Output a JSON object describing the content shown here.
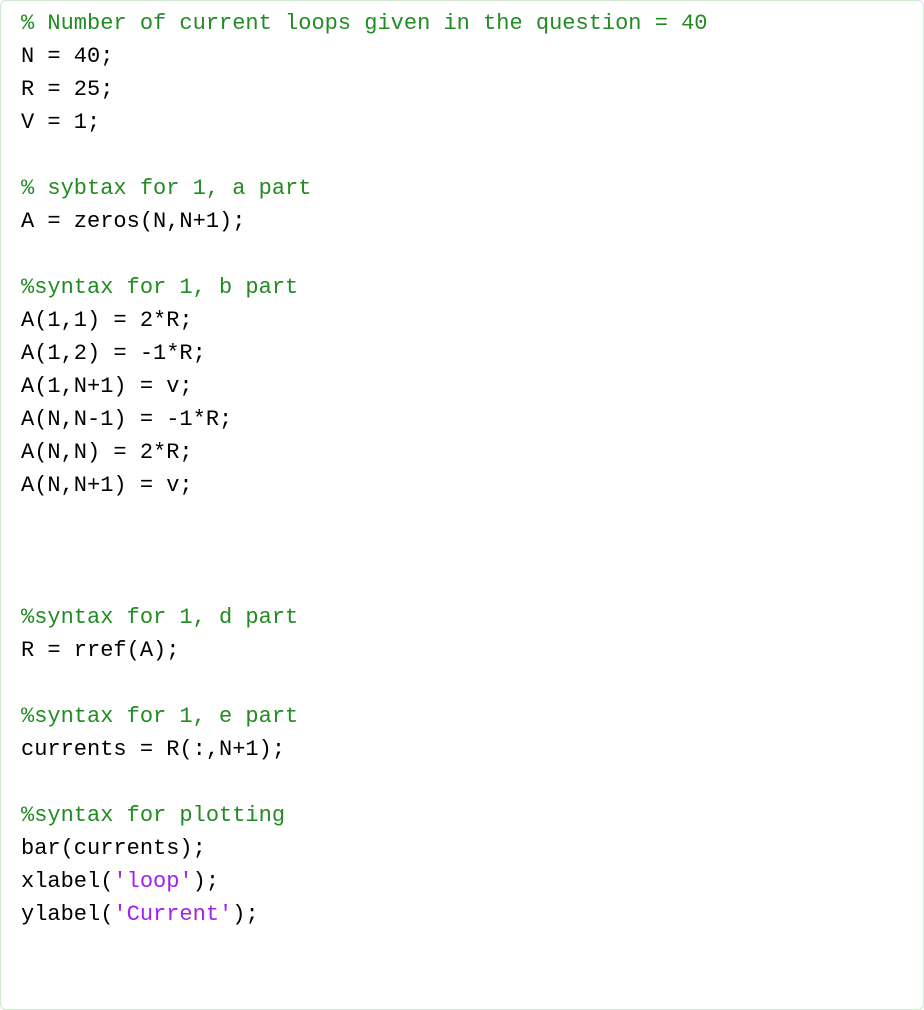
{
  "code": {
    "lines": [
      {
        "tokens": [
          {
            "cls": "tok-comment",
            "text": "% Number of current loops given in the question = 40"
          }
        ]
      },
      {
        "tokens": [
          {
            "cls": "tok-plain",
            "text": "N = 40;"
          }
        ]
      },
      {
        "tokens": [
          {
            "cls": "tok-plain",
            "text": "R = 25;"
          }
        ]
      },
      {
        "tokens": [
          {
            "cls": "tok-plain",
            "text": "V = 1;"
          }
        ]
      },
      {
        "tokens": [
          {
            "cls": "tok-plain",
            "text": ""
          }
        ]
      },
      {
        "tokens": [
          {
            "cls": "tok-comment",
            "text": "% sybtax for 1, a part"
          }
        ]
      },
      {
        "tokens": [
          {
            "cls": "tok-plain",
            "text": "A = zeros(N,N+1);"
          }
        ]
      },
      {
        "tokens": [
          {
            "cls": "tok-plain",
            "text": ""
          }
        ]
      },
      {
        "tokens": [
          {
            "cls": "tok-comment",
            "text": "%syntax for 1, b part"
          }
        ]
      },
      {
        "tokens": [
          {
            "cls": "tok-plain",
            "text": "A(1,1) = 2*R;"
          }
        ]
      },
      {
        "tokens": [
          {
            "cls": "tok-plain",
            "text": "A(1,2) = -1*R;"
          }
        ]
      },
      {
        "tokens": [
          {
            "cls": "tok-plain",
            "text": "A(1,N+1) = v;"
          }
        ]
      },
      {
        "tokens": [
          {
            "cls": "tok-plain",
            "text": "A(N,N-1) = -1*R;"
          }
        ]
      },
      {
        "tokens": [
          {
            "cls": "tok-plain",
            "text": "A(N,N) = 2*R;"
          }
        ]
      },
      {
        "tokens": [
          {
            "cls": "tok-plain",
            "text": "A(N,N+1) = v;"
          }
        ]
      },
      {
        "tokens": [
          {
            "cls": "tok-plain",
            "text": ""
          }
        ]
      },
      {
        "tokens": [
          {
            "cls": "tok-plain",
            "text": ""
          }
        ]
      },
      {
        "tokens": [
          {
            "cls": "tok-plain",
            "text": ""
          }
        ]
      },
      {
        "tokens": [
          {
            "cls": "tok-comment",
            "text": "%syntax for 1, d part"
          }
        ]
      },
      {
        "tokens": [
          {
            "cls": "tok-plain",
            "text": "R = rref(A);"
          }
        ]
      },
      {
        "tokens": [
          {
            "cls": "tok-plain",
            "text": ""
          }
        ]
      },
      {
        "tokens": [
          {
            "cls": "tok-comment",
            "text": "%syntax for 1, e part"
          }
        ]
      },
      {
        "tokens": [
          {
            "cls": "tok-plain",
            "text": "currents = R(:,N+1);"
          }
        ]
      },
      {
        "tokens": [
          {
            "cls": "tok-plain",
            "text": ""
          }
        ]
      },
      {
        "tokens": [
          {
            "cls": "tok-comment",
            "text": "%syntax for plotting"
          }
        ]
      },
      {
        "tokens": [
          {
            "cls": "tok-plain",
            "text": "bar(currents);"
          }
        ]
      },
      {
        "tokens": [
          {
            "cls": "tok-plain",
            "text": "xlabel("
          },
          {
            "cls": "tok-string",
            "text": "'loop'"
          },
          {
            "cls": "tok-plain",
            "text": ");"
          }
        ]
      },
      {
        "tokens": [
          {
            "cls": "tok-plain",
            "text": "ylabel("
          },
          {
            "cls": "tok-string",
            "text": "'Current'"
          },
          {
            "cls": "tok-plain",
            "text": ");"
          }
        ]
      }
    ]
  }
}
